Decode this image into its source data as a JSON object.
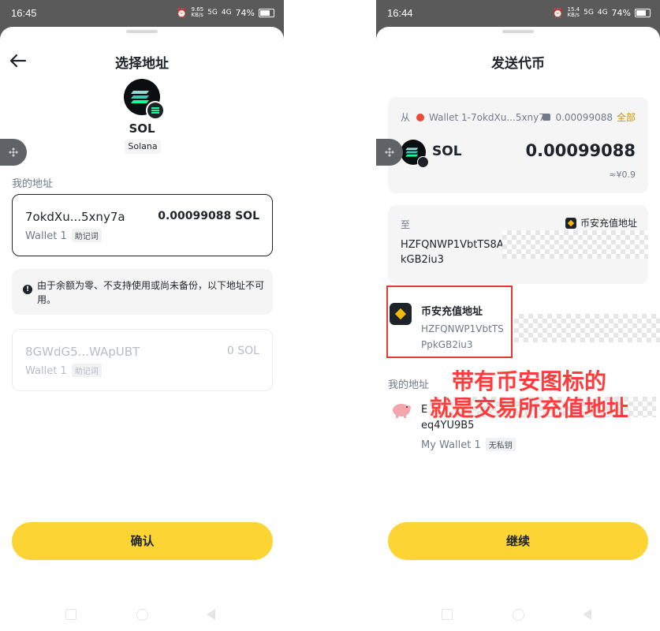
{
  "left": {
    "status": {
      "time": "16:45",
      "net_speed": "9.65\nKB/s",
      "net": "5G",
      "signal": "4G",
      "battery": "74%"
    },
    "title": "选择地址",
    "coin": {
      "symbol": "SOL",
      "network": "Solana"
    },
    "section_label": "我的地址",
    "selected_address": {
      "address": "7okdXu...5xny7a",
      "balance": "0.00099088 SOL",
      "wallet": "Wallet 1",
      "tag": "助记词"
    },
    "notice": "由于余额为零、不支持使用或尚未备份，以下地址不可用。",
    "disabled_address": {
      "address": "8GWdG5...WApUBT",
      "balance": "0 SOL",
      "wallet": "Wallet 1",
      "tag": "助记词"
    },
    "confirm_label": "确认"
  },
  "right": {
    "status": {
      "time": "16:44",
      "net_speed": "15.4\nKB/s",
      "net": "5G",
      "signal": "4G",
      "battery": "74%"
    },
    "title": "发送代币",
    "from": {
      "label": "从",
      "wallet": "Wallet 1-7okdXu...5xny7a",
      "balance": "0.00099088",
      "all_label": "全部"
    },
    "token": {
      "symbol": "SOL",
      "amount": "0.00099088",
      "fiat": "≈¥0.9"
    },
    "to": {
      "label": "至",
      "exchange_label": "币安充值地址",
      "address_line1": "HZFQNWP1VbtTS8A",
      "address_line2": "kGB2iu3"
    },
    "suggestion": {
      "title": "币安充值地址",
      "address_line1": "HZFQNWP1VbtTS",
      "address_line2": "PpkGB2iu3"
    },
    "my_address_label": "我的地址",
    "my_wallet": {
      "address_prefix": "E",
      "address_line2": "eq4YU9B5",
      "wallet": "My Wallet 1",
      "tag": "无私钥"
    },
    "continue_label": "继续"
  },
  "annotation": {
    "line1": "带有币安图标的",
    "line2": "就是交易所充值地址"
  },
  "colors": {
    "accent": "#fcd535",
    "binance_yellow": "#f0b90b",
    "annotation_red": "#ff3b3b"
  }
}
